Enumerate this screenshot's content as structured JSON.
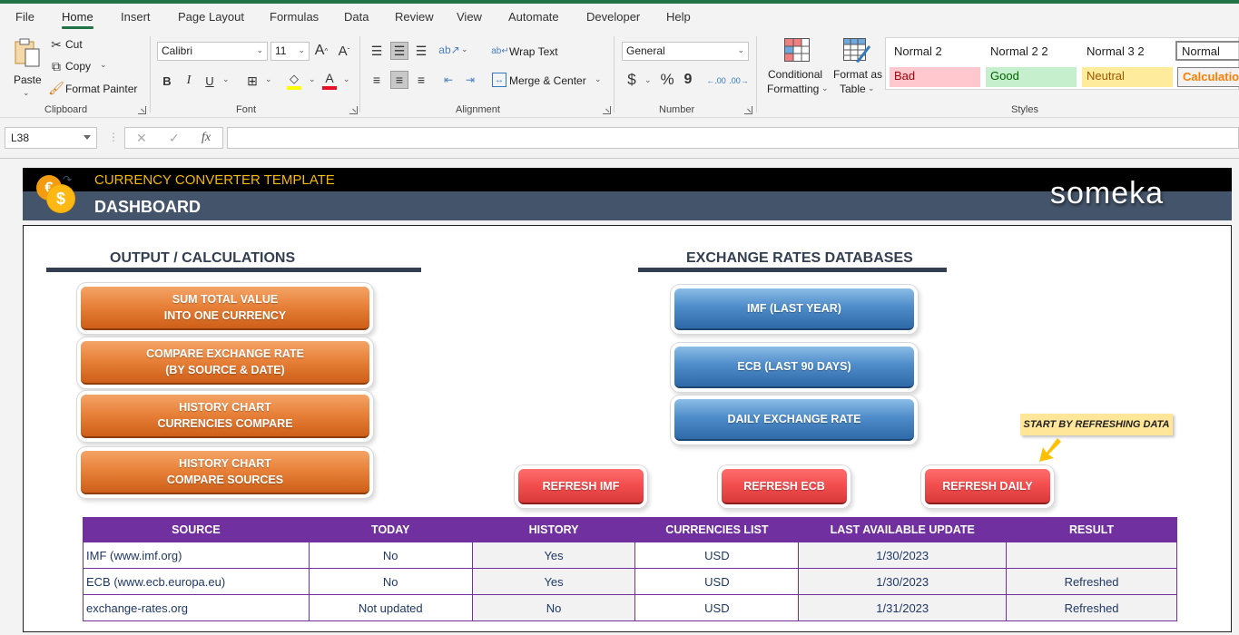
{
  "menu": {
    "tabs": [
      "File",
      "Home",
      "Insert",
      "Page Layout",
      "Formulas",
      "Data",
      "Review",
      "View",
      "Automate",
      "Developer",
      "Help"
    ],
    "active_tab": "Home"
  },
  "ribbon": {
    "clipboard": {
      "label": "Clipboard",
      "paste": "Paste",
      "cut": "Cut",
      "copy": "Copy",
      "format_painter": "Format Painter"
    },
    "font": {
      "label": "Font",
      "font_name": "Calibri",
      "font_size": "11",
      "bold": "B",
      "italic": "I",
      "underline": "U",
      "font_color_hex": "#e81123",
      "highlight_color_hex": "#ffff00"
    },
    "alignment": {
      "label": "Alignment",
      "wrap_text": "Wrap Text",
      "merge_center": "Merge & Center"
    },
    "number": {
      "label": "Number",
      "format": "General",
      "currency": "$",
      "percent": "%",
      "comma": "9"
    },
    "styles": {
      "label": "Styles",
      "conditional_formatting_1": "Conditional",
      "conditional_formatting_2": "Formatting",
      "format_as_table_1": "Format as",
      "format_as_table_2": "Table",
      "gallery": [
        {
          "label": "Normal 2",
          "bg": "#ffffff",
          "color": "#000000"
        },
        {
          "label": "Normal 2 2",
          "bg": "#ffffff",
          "color": "#000000"
        },
        {
          "label": "Normal 3 2",
          "bg": "#ffffff",
          "color": "#000000"
        },
        {
          "label": "Normal",
          "bg": "#ffffff",
          "color": "#000000"
        },
        {
          "label": "Bad",
          "bg": "#ffc7ce",
          "color": "#9c0006"
        },
        {
          "label": "Good",
          "bg": "#c6efce",
          "color": "#006100"
        },
        {
          "label": "Neutral",
          "bg": "#ffeb9c",
          "color": "#9c5700"
        },
        {
          "label": "Calculation",
          "bg": "#f2f2f2",
          "color": "#fa7d00"
        }
      ]
    }
  },
  "formula_bar": {
    "name_box": "L38",
    "cancel": "✕",
    "enter": "✓",
    "fx": "fx",
    "formula": ""
  },
  "banner": {
    "title": "CURRENCY CONVERTER TEMPLATE",
    "subtitle": "DASHBOARD",
    "logo": "someka"
  },
  "output_section": {
    "title": "OUTPUT / CALCULATIONS",
    "buttons": [
      {
        "line1": "SUM TOTAL VALUE",
        "line2": "INTO ONE CURRENCY"
      },
      {
        "line1": "COMPARE EXCHANGE RATE",
        "line2": "(BY SOURCE & DATE)"
      },
      {
        "line1": "HISTORY CHART",
        "line2": "CURRENCIES COMPARE"
      },
      {
        "line1": "HISTORY CHART",
        "line2": "COMPARE SOURCES"
      }
    ]
  },
  "databases_section": {
    "title": "EXCHANGE RATES DATABASES",
    "buttons": [
      "IMF (LAST YEAR)",
      "ECB (LAST 90 DAYS)",
      "DAILY EXCHANGE RATE"
    ]
  },
  "refresh_buttons": [
    "REFRESH IMF",
    "REFRESH ECB",
    "REFRESH DAILY"
  ],
  "callout": "START BY REFRESHING DATA",
  "table": {
    "headers": [
      "SOURCE",
      "TODAY",
      "HISTORY",
      "CURRENCIES LIST",
      "LAST AVAILABLE UPDATE",
      "RESULT"
    ],
    "rows": [
      [
        "IMF (www.imf.org)",
        "No",
        "Yes",
        "USD",
        "1/30/2023",
        ""
      ],
      [
        "ECB (www.ecb.europa.eu)",
        "No",
        "Yes",
        "USD",
        "1/30/2023",
        "Refreshed"
      ],
      [
        "exchange-rates.org",
        "Not updated",
        "No",
        "USD",
        "1/31/2023",
        "Refreshed"
      ]
    ]
  },
  "colors": {
    "excel_green": "#217346",
    "banner_dark": "#000000",
    "banner_slate": "#44546a",
    "title_gold": "#f5b800",
    "table_header": "#7030a0",
    "orange_button": "#e8823a",
    "blue_button": "#4f8cca",
    "red_button": "#f24d4d",
    "callout_bg": "#ffe699"
  }
}
